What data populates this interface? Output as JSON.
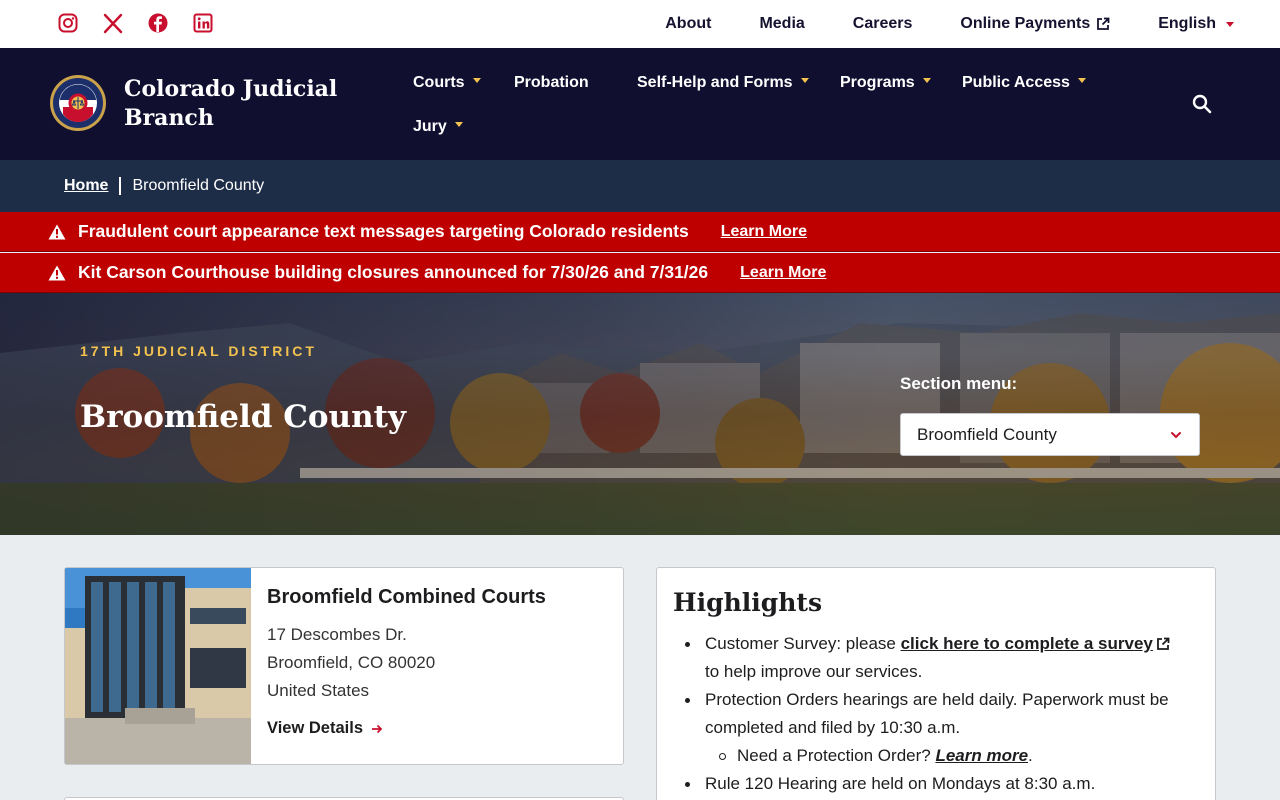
{
  "utility": {
    "social_icons": [
      "instagram-icon",
      "x-icon",
      "facebook-icon",
      "linkedin-icon"
    ],
    "links": {
      "about": "About",
      "media": "Media",
      "careers": "Careers",
      "payments": "Online Payments",
      "language": "English"
    }
  },
  "nav": {
    "brand_line1": "Colorado Judicial",
    "brand_line2": "Branch",
    "courts": "Courts",
    "probation": "Probation",
    "self_help": "Self-Help and Forms",
    "programs": "Programs",
    "public_access": "Public Access",
    "jury": "Jury"
  },
  "breadcrumb": {
    "home": "Home",
    "current": "Broomfield County"
  },
  "alerts": [
    {
      "text": "Fraudulent court appearance text messages targeting Colorado residents",
      "link": "Learn More"
    },
    {
      "text": "Kit Carson Courthouse building closures announced for 7/30/26 and 7/31/26",
      "link": "Learn More"
    }
  ],
  "hero": {
    "eyebrow": "17TH JUDICIAL DISTRICT",
    "title": "Broomfield County",
    "section_label": "Section menu:",
    "section_value": "Broomfield County"
  },
  "court": {
    "name": "Broomfield Combined Courts",
    "address1": "17 Descombes Dr.",
    "address2": "Broomfield, CO 80020",
    "address3": "United States",
    "view_details": "View Details"
  },
  "highlights": {
    "title": "Highlights",
    "survey_prefix": "Customer Survey:",
    "survey_please": " please ",
    "survey_link": "click here to complete a survey",
    "survey_suffix": "to help improve our services.",
    "protection": "Protection Orders hearings are held daily. Paperwork must be completed and filed by 10:30 a.m.",
    "need_po": "Need a Protection Order? ",
    "learn_more": "Learn more",
    "period": ".",
    "rule120": "Rule 120 Hearing are held on Mondays at 8:30 a.m."
  },
  "colors": {
    "navy": "#110f30",
    "breadcrumb_bg": "#1d2d47",
    "alert_red": "#bf0000",
    "gold_accent": "#f3c24f",
    "brand_red": "#c8102e"
  }
}
